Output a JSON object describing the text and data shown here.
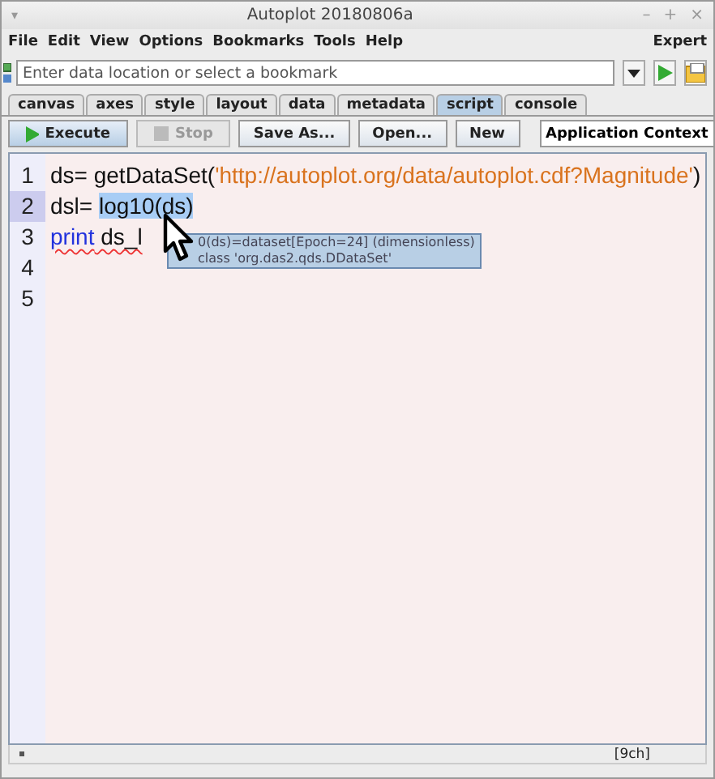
{
  "window": {
    "title": "Autoplot 20180806a",
    "menu_glyph": "▾",
    "controls": [
      "–",
      "+",
      "×"
    ]
  },
  "menu": {
    "items": [
      "File",
      "Edit",
      "View",
      "Options",
      "Bookmarks",
      "Tools",
      "Help"
    ],
    "right": "Expert"
  },
  "address": {
    "placeholder": "Enter data location or select a bookmark"
  },
  "tabs": [
    {
      "label": "canvas",
      "selected": false
    },
    {
      "label": "axes",
      "selected": false
    },
    {
      "label": "style",
      "selected": false
    },
    {
      "label": "layout",
      "selected": false
    },
    {
      "label": "data",
      "selected": false
    },
    {
      "label": "metadata",
      "selected": false
    },
    {
      "label": "script",
      "selected": true
    },
    {
      "label": "console",
      "selected": false
    }
  ],
  "toolbar": {
    "buttons": [
      {
        "label": "Execute",
        "kind": "run",
        "disabled": false
      },
      {
        "label": "Stop",
        "kind": "stop",
        "disabled": true
      },
      {
        "label": "Save As...",
        "kind": "plain",
        "disabled": false
      },
      {
        "label": "Open...",
        "kind": "plain",
        "disabled": false
      },
      {
        "label": "New",
        "kind": "plain",
        "disabled": false
      }
    ],
    "context": "Application Context"
  },
  "editor": {
    "lines": [
      {
        "number": "1",
        "current": false,
        "tokens": [
          {
            "text": "ds= getDataSet(",
            "kind": "plain",
            "selected": false,
            "error": false
          },
          {
            "text": "'http://autoplot.org/data/autoplot.cdf?Magnitude'",
            "kind": "string",
            "selected": false,
            "error": false
          },
          {
            "text": ")",
            "kind": "plain",
            "selected": false,
            "error": false
          }
        ]
      },
      {
        "number": "2",
        "current": true,
        "tokens": [
          {
            "text": "dsl= ",
            "kind": "plain",
            "selected": false,
            "error": false
          },
          {
            "text": "log10(ds)",
            "kind": "plain",
            "selected": true,
            "error": false
          }
        ]
      },
      {
        "number": "3",
        "current": false,
        "tokens": [
          {
            "text": "print",
            "kind": "keyword",
            "selected": false,
            "error": true
          },
          {
            "text": " ds_l",
            "kind": "plain",
            "selected": false,
            "error": true
          }
        ]
      },
      {
        "number": "4",
        "current": false
      },
      {
        "number": "5",
        "current": false
      }
    ],
    "tooltip": [
      "0(ds)=dataset[Epoch=24] (dimensionless)",
      "class 'org.das2.qds.DDataSet'"
    ]
  },
  "status": {
    "position": "[9ch]"
  }
}
